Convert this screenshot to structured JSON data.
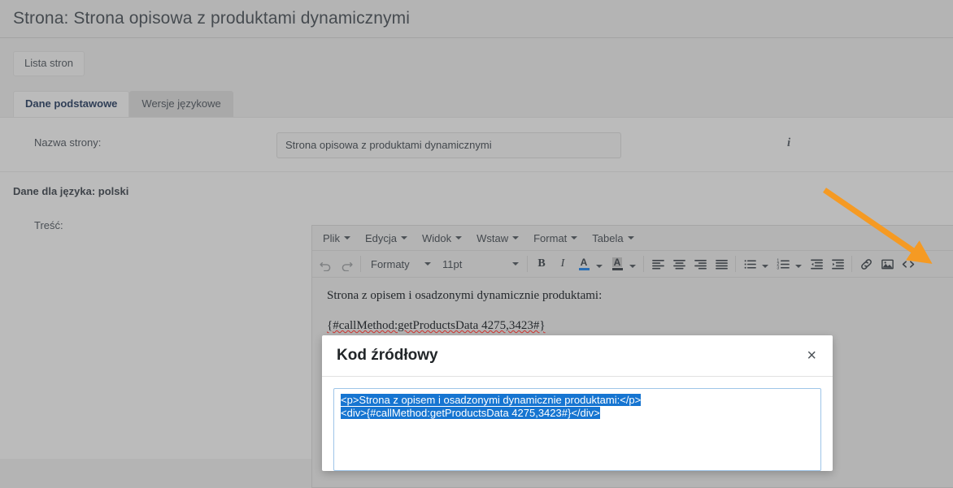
{
  "header": {
    "title": "Strona: Strona opisowa z produktami dynamicznymi"
  },
  "toolbar": {
    "list_pages_label": "Lista stron"
  },
  "tabs": [
    {
      "label": "Dane podstawowe",
      "active": true
    },
    {
      "label": "Wersje językowe",
      "active": false
    }
  ],
  "form": {
    "page_name_label": "Nazwa strony:",
    "page_name_value": "Strona opisowa z produktami dynamicznymi",
    "page_name_placeholder": "",
    "info_icon": "info-icon",
    "language_section_heading": "Dane dla języka: polski",
    "content_label": "Treść:"
  },
  "editor": {
    "menu": [
      {
        "label": "Plik"
      },
      {
        "label": "Edycja"
      },
      {
        "label": "Widok"
      },
      {
        "label": "Wstaw"
      },
      {
        "label": "Format"
      },
      {
        "label": "Tabela"
      }
    ],
    "toolbar": {
      "undo": "undo-icon",
      "redo": "redo-icon",
      "formats_label": "Formaty",
      "fontsize_label": "11pt",
      "bold_label": "B",
      "italic_label": "I",
      "textcolor_label": "A",
      "backcolor_label": "A",
      "icons": [
        "align-left-icon",
        "align-center-icon",
        "align-right-icon",
        "align-justify-icon",
        "bullet-list-icon",
        "numbered-list-icon",
        "outdent-icon",
        "indent-icon",
        "link-icon",
        "image-icon",
        "source-code-icon"
      ]
    },
    "content": [
      "Strona z opisem i osadzonymi dynamicznie produktami:",
      "{#callMethod:getProductsData 4275,3423#}"
    ]
  },
  "modal": {
    "title": "Kod źródłowy",
    "close_label": "×",
    "code_lines": [
      "<p>Strona z opisem i osadzonymi dynamicznie produktami:</p>",
      "<div>{#callMethod:getProductsData 4275,3423#}</div>"
    ]
  },
  "annotation": {
    "arrow_color": "#f59a23"
  }
}
